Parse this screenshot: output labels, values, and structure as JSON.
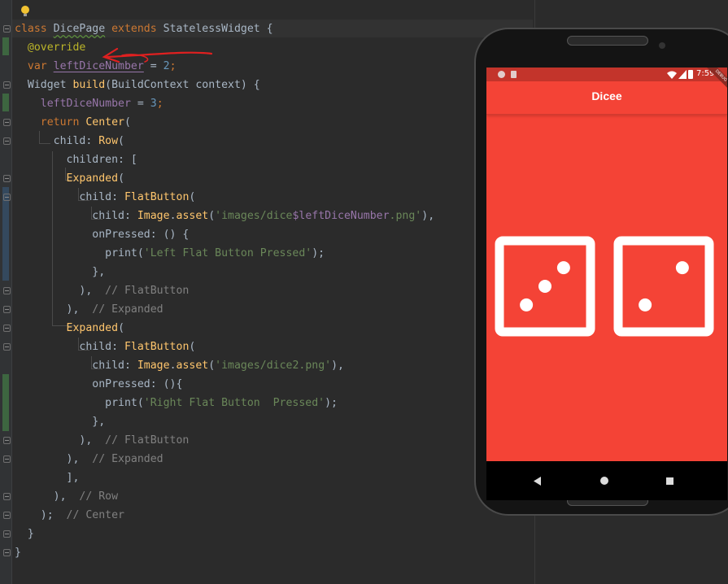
{
  "editor": {
    "lines": [
      [
        {
          "t": "class ",
          "c": "kw"
        },
        {
          "t": "DicePage",
          "c": "plain wavy"
        },
        {
          "t": " extends ",
          "c": "kw"
        },
        {
          "t": "StatelessWidget {",
          "c": "plain"
        }
      ],
      [
        {
          "t": "  ",
          "c": "plain"
        },
        {
          "t": "@override",
          "c": "ann"
        }
      ],
      [
        {
          "t": "  ",
          "c": "plain"
        },
        {
          "t": "var ",
          "c": "kw"
        },
        {
          "t": "leftDiceNumber",
          "c": "field ul"
        },
        {
          "t": " = ",
          "c": "plain"
        },
        {
          "t": "2",
          "c": "num"
        },
        {
          "t": ";",
          "c": "kw"
        }
      ],
      [
        {
          "t": "  Widget ",
          "c": "plain"
        },
        {
          "t": "build",
          "c": "fn"
        },
        {
          "t": "(BuildContext context) {",
          "c": "plain"
        }
      ],
      [
        {
          "t": "    ",
          "c": "plain"
        },
        {
          "t": "leftDiceNumber",
          "c": "field"
        },
        {
          "t": " = ",
          "c": "plain"
        },
        {
          "t": "3",
          "c": "num"
        },
        {
          "t": ";",
          "c": "kw"
        }
      ],
      [
        {
          "t": "    ",
          "c": "plain"
        },
        {
          "t": "return ",
          "c": "kw"
        },
        {
          "t": "Center",
          "c": "fn"
        },
        {
          "t": "(",
          "c": "plain"
        }
      ],
      [
        {
          "t": "      child: ",
          "c": "plain"
        },
        {
          "t": "Row",
          "c": "fn"
        },
        {
          "t": "(",
          "c": "plain"
        }
      ],
      [
        {
          "t": "        children: [",
          "c": "plain"
        }
      ],
      [
        {
          "t": "        ",
          "c": "plain"
        },
        {
          "t": "Expanded",
          "c": "fn"
        },
        {
          "t": "(",
          "c": "plain"
        }
      ],
      [
        {
          "t": "          child: ",
          "c": "plain"
        },
        {
          "t": "FlatButton",
          "c": "fn"
        },
        {
          "t": "(",
          "c": "plain"
        }
      ],
      [
        {
          "t": "            child: ",
          "c": "plain"
        },
        {
          "t": "Image",
          "c": "fn"
        },
        {
          "t": ".",
          "c": "plain"
        },
        {
          "t": "asset",
          "c": "fn"
        },
        {
          "t": "(",
          "c": "plain"
        },
        {
          "t": "'images/dice",
          "c": "str"
        },
        {
          "t": "$leftDiceNumber",
          "c": "field"
        },
        {
          "t": ".png'",
          "c": "str"
        },
        {
          "t": "),",
          "c": "plain"
        }
      ],
      [
        {
          "t": "            onPressed: () {",
          "c": "plain"
        }
      ],
      [
        {
          "t": "              print(",
          "c": "plain"
        },
        {
          "t": "'Left Flat Button Pressed'",
          "c": "str"
        },
        {
          "t": ");",
          "c": "plain"
        }
      ],
      [
        {
          "t": "            },",
          "c": "plain"
        }
      ],
      [
        {
          "t": "          ),  ",
          "c": "plain"
        },
        {
          "t": "// FlatButton",
          "c": "cmt"
        }
      ],
      [
        {
          "t": "        ),  ",
          "c": "plain"
        },
        {
          "t": "// Expanded",
          "c": "cmt"
        }
      ],
      [
        {
          "t": "        ",
          "c": "plain"
        },
        {
          "t": "Expanded",
          "c": "fn"
        },
        {
          "t": "(",
          "c": "plain"
        }
      ],
      [
        {
          "t": "          child: ",
          "c": "plain"
        },
        {
          "t": "FlatButton",
          "c": "fn"
        },
        {
          "t": "(",
          "c": "plain"
        }
      ],
      [
        {
          "t": "            child: ",
          "c": "plain"
        },
        {
          "t": "Image",
          "c": "fn"
        },
        {
          "t": ".",
          "c": "plain"
        },
        {
          "t": "asset",
          "c": "fn"
        },
        {
          "t": "(",
          "c": "plain"
        },
        {
          "t": "'images/dice2.png'",
          "c": "str"
        },
        {
          "t": "),",
          "c": "plain"
        }
      ],
      [
        {
          "t": "            onPressed: (){",
          "c": "plain"
        }
      ],
      [
        {
          "t": "              print(",
          "c": "plain"
        },
        {
          "t": "'Right Flat Button  Pressed'",
          "c": "str"
        },
        {
          "t": ");",
          "c": "plain"
        }
      ],
      [
        {
          "t": "            },",
          "c": "plain"
        }
      ],
      [
        {
          "t": "          ),  ",
          "c": "plain"
        },
        {
          "t": "// FlatButton",
          "c": "cmt"
        }
      ],
      [
        {
          "t": "        ),  ",
          "c": "plain"
        },
        {
          "t": "// Expanded",
          "c": "cmt"
        }
      ],
      [
        {
          "t": "        ],",
          "c": "plain"
        }
      ],
      [
        {
          "t": "      ),  ",
          "c": "plain"
        },
        {
          "t": "// Row",
          "c": "cmt"
        }
      ],
      [
        {
          "t": "    );  ",
          "c": "plain"
        },
        {
          "t": "// Center",
          "c": "cmt"
        }
      ],
      [
        {
          "t": "  }",
          "c": "plain"
        }
      ],
      [
        {
          "t": "}",
          "c": "plain"
        }
      ]
    ]
  },
  "phone": {
    "app_title": "Dicee",
    "status_time": "7:59",
    "debug_banner": "DEBUG",
    "left_die_value": 3,
    "right_die_value": 2,
    "accent_color": "#f44336"
  },
  "colors": {
    "editor_bg": "#2b2b2b",
    "keyword": "#cc7832",
    "string": "#6a8759",
    "comment": "#808080",
    "annotation_arrow": "#e02020"
  }
}
